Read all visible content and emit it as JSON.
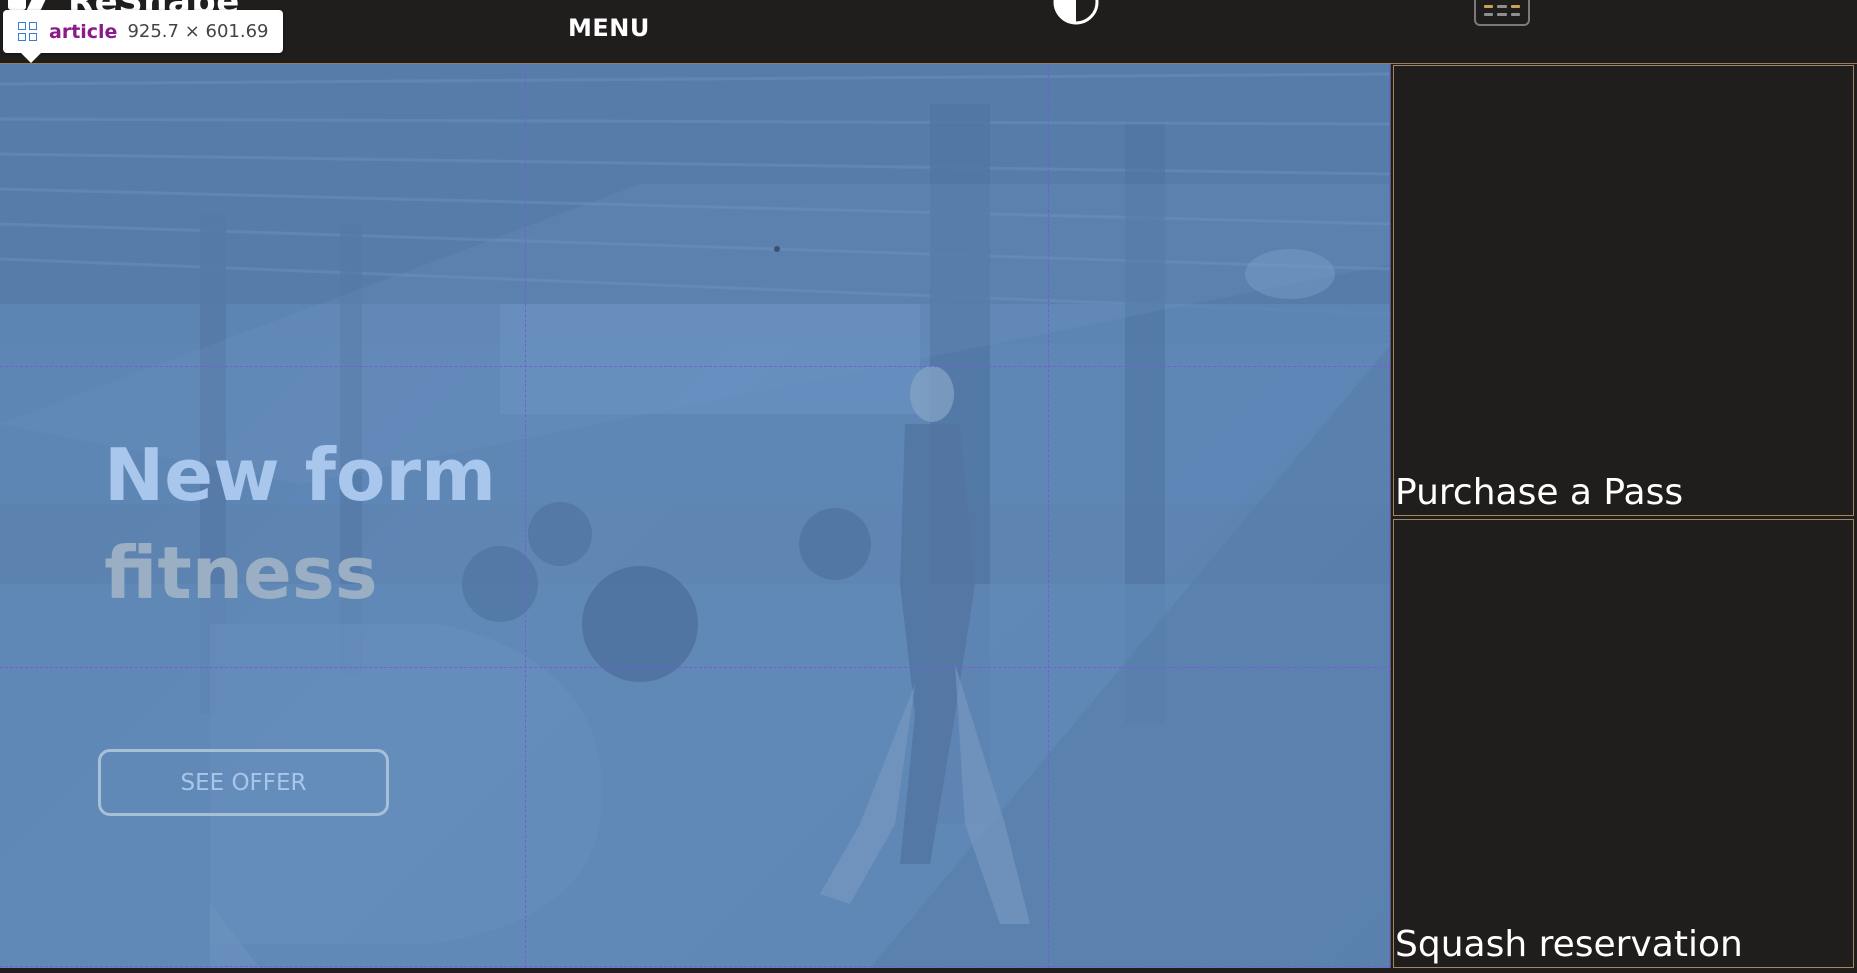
{
  "header": {
    "logo_text": "ReShape",
    "menu_label": "MENU",
    "contrast_icon": "half-circle-contrast-icon",
    "schedule_icon": "schedule-grid-icon"
  },
  "inspect_tooltip": {
    "tag": "article",
    "size": "925.7 × 601.69"
  },
  "hero": {
    "title_line1": "New form",
    "title_line2": "fitness",
    "cta_label": "SEE OFFER"
  },
  "tiles": [
    {
      "label": "Purchase a Pass"
    },
    {
      "label": "Squash reservation"
    }
  ],
  "colors": {
    "background": "#201e1c",
    "tile_border": "#a4865f",
    "overlay_blue": "#6088ba",
    "grid_overlay": "#7a5ad8",
    "accent_gold": "#c9a25a"
  }
}
